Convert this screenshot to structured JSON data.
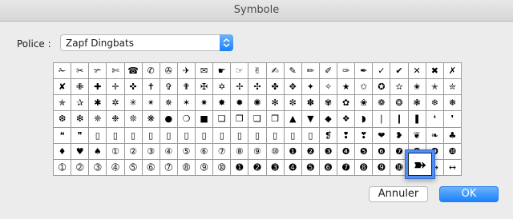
{
  "window": {
    "title": "Symbole"
  },
  "font": {
    "label": "Police :",
    "value": "Zapf Dingbats"
  },
  "grid": {
    "rows": [
      [
        "✁",
        "✂",
        "✃",
        "✄",
        "☎",
        "✆",
        "✇",
        "✈",
        "✉",
        "☛",
        "☞",
        "✌",
        "✍",
        "✎",
        "✏",
        "✐",
        "✑",
        "✒",
        "✓",
        "✔",
        "✕",
        "✖",
        "✗",
        "✘",
        "✙",
        "✚",
        "✛"
      ],
      [
        "✜",
        "✝",
        "✞",
        "✟",
        "✠",
        "✡",
        "✢",
        "✣",
        "✤",
        "✥",
        "✦",
        "✧",
        "★",
        "✩",
        "✪",
        "✫",
        "✬",
        "✭",
        "✮",
        "✯",
        "✰",
        "✱",
        "✲",
        "✳",
        "✴",
        "✵",
        "✶"
      ],
      [
        "✷",
        "✸",
        "✹",
        "✺",
        "✻",
        "✼",
        "✽",
        "✾",
        "✿",
        "❀",
        "❁",
        "❂",
        "❃",
        "❄",
        "❅",
        "❆",
        "❇",
        "❈",
        "❉",
        "❊",
        "❋",
        "●",
        "❍",
        "■",
        "❏",
        "❐",
        "❑"
      ],
      [
        "❒",
        "▲",
        "▼",
        "◆",
        "❖",
        "◗",
        "❘",
        "❙",
        "❚",
        "❛",
        "❜",
        "❝",
        "❞",
        "▯",
        "❨",
        "❩",
        "❪",
        "❫",
        "❬",
        "❭",
        "❮",
        "❯",
        "❰",
        "❱",
        "❲",
        "❳",
        "❴"
      ],
      [
        "❵",
        "▯",
        "▯",
        "▯",
        "▯",
        "▯",
        "▯",
        "▯",
        "▯",
        "▯",
        "▯",
        "▯",
        "▯",
        "▯",
        "▯",
        "❡",
        "❢",
        "❣",
        "❤",
        "❥",
        "❦",
        "❧",
        "♣",
        "♦",
        "♥",
        "♠",
        "①"
      ],
      [
        "①",
        "②",
        "③",
        "④",
        "⑤",
        "⑥",
        "⑦",
        "⑧",
        "⑨",
        "⑩",
        "❶",
        "❷",
        "❸",
        "❹",
        "❺",
        "❻",
        "❼",
        "❽",
        "❾",
        "❿",
        "➀",
        "➁",
        "➂",
        "➃",
        "➄",
        "➅",
        "➆"
      ],
      [
        "➇",
        "➈",
        "➉",
        "➊",
        "➋",
        "➌",
        "➍",
        "➎",
        "➏",
        "➐",
        "➑",
        "➒",
        "➓",
        "➔",
        "→",
        "↔",
        "↕",
        "➘",
        "➙",
        "➚",
        "➛",
        "➜",
        "➝",
        "➞",
        "➟",
        "➠",
        "➡"
      ],
      [
        "➢",
        "➣",
        "➤",
        "➥",
        "➦",
        "➧",
        "➨",
        "➩",
        "➪",
        "➫",
        "➬",
        "➭",
        "➮",
        "➯",
        "▯",
        "➱",
        "➲",
        "➳",
        "➴",
        "➵",
        "➶",
        "➷",
        "➸",
        "➹",
        "➺",
        "➻",
        "➼",
        "➽",
        "➾",
        "▯"
      ]
    ]
  },
  "visible_rows": [
    [
      "✁",
      "✂",
      "✃",
      "✄",
      "☎",
      "✆",
      "✇",
      "✈",
      "✉",
      "☛",
      "☞",
      "✌",
      "✍",
      "✎",
      "✏",
      "✐",
      "✑",
      "✒",
      "✓",
      "✔",
      "✕",
      "✖",
      "✗"
    ],
    [
      "✘",
      "✙",
      "✚",
      "✛",
      "✜",
      "✝",
      "✞",
      "✟",
      "✠",
      "✡",
      "✢",
      "✣",
      "✤",
      "✥",
      "✦",
      "✧",
      "★",
      "✩",
      "✪",
      "✫",
      "✬",
      "✭",
      "✮"
    ],
    [
      "✯",
      "✰",
      "✱",
      "✲",
      "✳",
      "✴",
      "✵",
      "✶",
      "✷",
      "✸",
      "✹",
      "✺",
      "✻",
      "✼",
      "✽",
      "✾",
      "✿",
      "❀",
      "❁",
      "❂",
      "❃",
      "❄",
      "❅"
    ],
    [
      "❆",
      "❇",
      "❈",
      "❉",
      "❊",
      "❋",
      "●",
      "❍",
      "■",
      "❏",
      "❐",
      "❑",
      "❒",
      "▲",
      "▼",
      "◆",
      "❖",
      "◗",
      "❘",
      "❙",
      "❚",
      "❛",
      "❜"
    ],
    [
      "❝",
      "❞",
      "▯",
      "▯",
      "▯",
      "▯",
      "▯",
      "▯",
      "▯",
      "▯",
      "▯",
      "▯",
      "▯",
      "▯",
      "▯",
      "❡",
      "❢",
      "❣",
      "❤",
      "❥",
      "❦",
      "❧",
      "♣"
    ],
    [
      "♦",
      "♥",
      "♠",
      "①",
      "②",
      "③",
      "④",
      "⑤",
      "⑥",
      "⑦",
      "⑧",
      "⑨",
      "⑩",
      "❶",
      "❷",
      "❸",
      "❹",
      "❺",
      "❻",
      "❼",
      "❽",
      "❾",
      "❿"
    ],
    [
      "➀",
      "➁",
      "➂",
      "➃",
      "➄",
      "➅",
      "➆",
      "➇",
      "➈",
      "➉",
      "➊",
      "➋",
      "➌",
      "➍",
      "➎",
      "➏",
      "➐",
      "➑",
      "➒",
      "➓",
      "➔",
      "→",
      "↔"
    ]
  ],
  "selected_glyph": "➽",
  "buttons": {
    "cancel": "Annuler",
    "ok": "OK"
  }
}
